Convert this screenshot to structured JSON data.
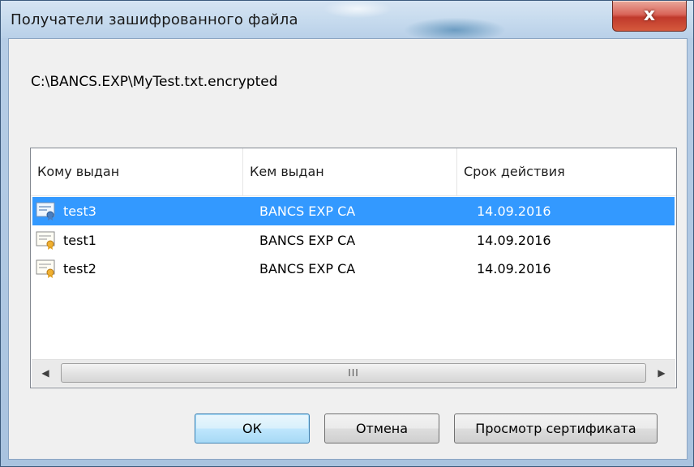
{
  "window": {
    "title": "Получатели зашифрованного файла",
    "close_label": "x"
  },
  "file_path": "C:\\BANCS.EXP\\MyTest.txt.encrypted",
  "list": {
    "columns": [
      "Кому выдан",
      "Кем выдан",
      "Срок действия"
    ],
    "rows": [
      {
        "issued_to": "test3",
        "issued_by": "BANCS EXP CA",
        "expires": "14.09.2016",
        "selected": true,
        "icon": "certificate-icon"
      },
      {
        "issued_to": "test1",
        "issued_by": "BANCS EXP CA",
        "expires": "14.09.2016",
        "selected": false,
        "icon": "certificate-icon"
      },
      {
        "issued_to": "test2",
        "issued_by": "BANCS EXP CA",
        "expires": "14.09.2016",
        "selected": false,
        "icon": "certificate-icon"
      }
    ],
    "scrollbar": {
      "left_arrow": "◀",
      "right_arrow": "▶",
      "grip": "III"
    }
  },
  "buttons": {
    "ok": "ОК",
    "cancel": "Отмена",
    "view_cert": "Просмотр сертификата"
  },
  "colors": {
    "selection": "#3399ff",
    "close_button": "#c0392b"
  }
}
